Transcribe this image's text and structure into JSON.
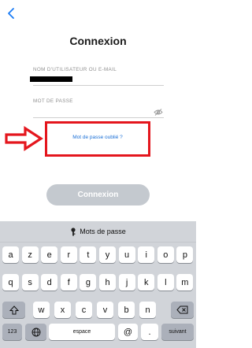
{
  "title": "Connexion",
  "username": {
    "label": "NOM D'UTILISATEUR OU E-MAIL",
    "value_redacted": true
  },
  "password": {
    "label": "MOT DE PASSE",
    "visibility_icon": "eye-slash-icon"
  },
  "forgot_link": "Mot de passe oublié ?",
  "login_button": "Connexion",
  "annotation": {
    "arrow_color": "#e4161d",
    "box_color": "#e4161d"
  },
  "keyboard": {
    "suggestion_icon": "key-icon",
    "suggestion": "Mots de passe",
    "row1": [
      "a",
      "z",
      "e",
      "r",
      "t",
      "y",
      "u",
      "i",
      "o",
      "p"
    ],
    "row2": [
      "q",
      "s",
      "d",
      "f",
      "g",
      "h",
      "j",
      "k",
      "l",
      "m"
    ],
    "row3": [
      "w",
      "x",
      "c",
      "v",
      "b",
      "n"
    ],
    "shift_icon": "shift-icon",
    "backspace_icon": "backspace-icon",
    "numbers": "123",
    "globe_icon": "globe-icon",
    "space": "espace",
    "at": "@",
    "dot": ".",
    "next": "suivant"
  }
}
